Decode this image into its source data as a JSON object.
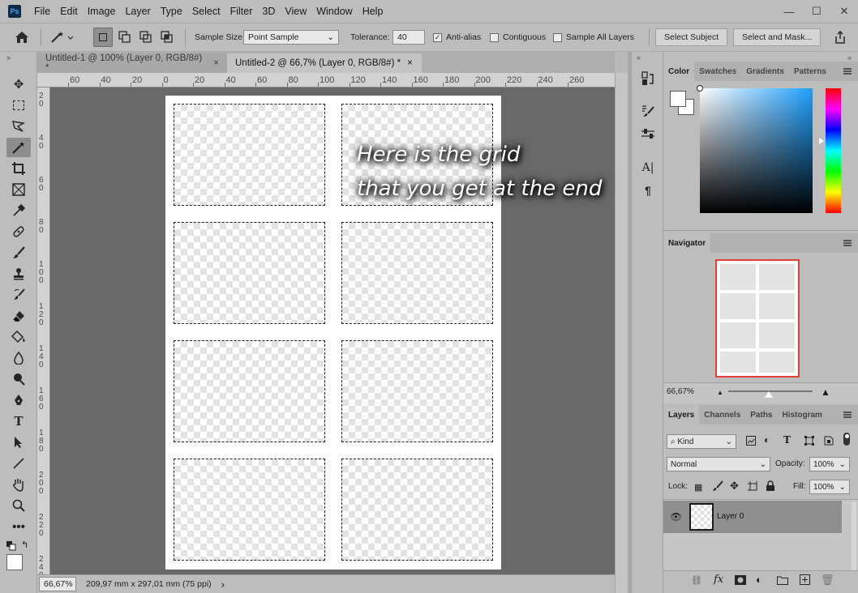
{
  "app": {
    "logo": "Ps"
  },
  "menu": [
    "File",
    "Edit",
    "Image",
    "Layer",
    "Type",
    "Select",
    "Filter",
    "3D",
    "View",
    "Window",
    "Help"
  ],
  "window_controls": {
    "minimize": "—",
    "maximize": "☐",
    "close": "✕"
  },
  "options": {
    "sample_size_label": "Sample Size:",
    "sample_size_value": "Point Sample",
    "tolerance_label": "Tolerance:",
    "tolerance_value": "40",
    "anti_alias_label": "Anti-alias",
    "anti_alias_checked": true,
    "contiguous_label": "Contiguous",
    "contiguous_checked": false,
    "sample_all_layers_label": "Sample All Layers",
    "sample_all_layers_checked": false,
    "select_subject_label": "Select Subject",
    "select_and_mask_label": "Select and Mask..."
  },
  "tabs": [
    {
      "label": "Untitled-1 @ 100% (Layer 0, RGB/8#) *",
      "close": "×",
      "active": false
    },
    {
      "label": "Untitled-2 @ 66,7% (Layer 0, RGB/8#) *",
      "close": "×",
      "active": true
    }
  ],
  "ruler_h_labels": [
    "60",
    "40",
    "20",
    "0",
    "20",
    "40",
    "60",
    "80",
    "100",
    "120",
    "140",
    "160",
    "180",
    "200",
    "220",
    "240",
    "260"
  ],
  "ruler_v_labels": [
    "2\n0",
    "4\n0",
    "6\n0",
    "8\n0",
    "1\n0\n0",
    "1\n2\n0",
    "1\n4\n0",
    "1\n6\n0",
    "1\n8\n0",
    "2\n0\n0",
    "2\n2\n0",
    "2\n4\n0"
  ],
  "overlay_text": {
    "line1": "Here is the grid",
    "line2": "that you get at the end"
  },
  "status": {
    "zoom": "66,67%",
    "doc_info": "209,97 mm x 297,01 mm (75 ppi)",
    "arrow": "›"
  },
  "color_panel": {
    "tabs": [
      "Color",
      "Swatches",
      "Gradients",
      "Patterns"
    ],
    "active_tab": "Color"
  },
  "navigator": {
    "title": "Navigator",
    "zoom": "66,67%"
  },
  "layers_panel": {
    "tabs": [
      "Layers",
      "Channels",
      "Paths",
      "Histogram"
    ],
    "kind_label": "Kind",
    "blend_mode": "Normal",
    "opacity_label": "Opacity:",
    "opacity_value": "100%",
    "lock_label": "Lock:",
    "fill_label": "Fill:",
    "fill_value": "100%",
    "layers": [
      {
        "name": "Layer 0",
        "visible": true
      }
    ]
  },
  "colors": {
    "accent_nav_frame": "#e0403a",
    "canvas_bg": "#696969"
  }
}
